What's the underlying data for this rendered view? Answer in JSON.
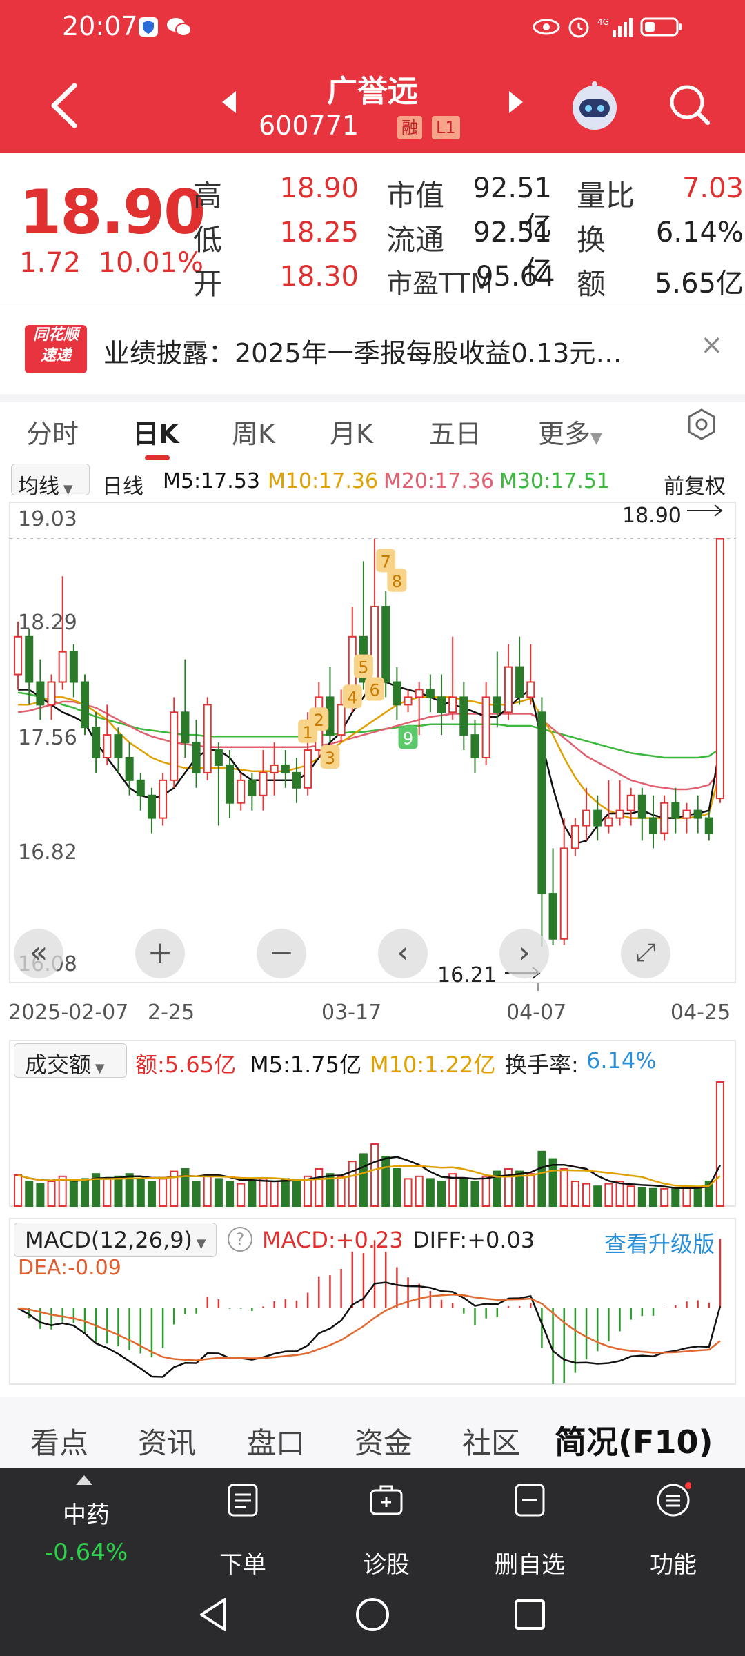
{
  "status_bar": {
    "time": "20:07"
  },
  "header": {
    "name": "广誉远",
    "code": "600771",
    "tags": [
      "融",
      "L1"
    ]
  },
  "quote": {
    "price": "18.90",
    "change": "1.72",
    "change_pct": "10.01%",
    "high_label": "高",
    "high": "18.90",
    "low_label": "低",
    "low": "18.25",
    "open_label": "开",
    "open": "18.30",
    "mktcap_label": "市值",
    "mktcap": "92.51亿",
    "float_label": "流通",
    "float": "92.51亿",
    "pe_label": "市盈TTM",
    "pe": "95.64",
    "vol_ratio_label": "量比",
    "vol_ratio": "7.03",
    "turnover_label": "换",
    "turnover": "6.14%",
    "amount_label": "额",
    "amount": "5.65亿"
  },
  "news": {
    "logo_line1": "同花顺",
    "logo_line2": "速递",
    "text": "业绩披露：2025年一季报每股收益0.13元…",
    "close": "×"
  },
  "tabs": [
    "分时",
    "日K",
    "周K",
    "月K",
    "五日",
    "更多"
  ],
  "active_tab": "日K",
  "legend": {
    "ma_select": "均线",
    "period": "日线",
    "m5": "M5:17.53",
    "m10": "M10:17.36",
    "m20": "M20:17.36",
    "m30": "M30:17.51",
    "adjust": "前复权",
    "colors": {
      "m5": "#111111",
      "m10": "#e0a000",
      "m20": "#e06070",
      "m30": "#3cb83c"
    }
  },
  "chart_data": {
    "type": "candlestick",
    "y_ticks": [
      "19.03",
      "18.29",
      "17.56",
      "16.82",
      "16.08"
    ],
    "ylim": [
      16.08,
      19.03
    ],
    "x_labels": [
      "2025-02-07",
      "2-25",
      "03-17",
      "04-07",
      "04-25"
    ],
    "max_marker": "18.90",
    "min_marker": "16.21",
    "signal_labels": [
      "1",
      "2",
      "3",
      "4",
      "5",
      "6",
      "7",
      "8",
      "9"
    ],
    "candles": [
      [
        18.0,
        18.25,
        17.9,
        18.35
      ],
      [
        18.25,
        17.95,
        17.8,
        18.3
      ],
      [
        17.95,
        17.8,
        17.7,
        18.1
      ],
      [
        17.8,
        17.95,
        17.7,
        18.0
      ],
      [
        17.95,
        18.15,
        17.9,
        18.65
      ],
      [
        18.15,
        17.95,
        17.85,
        18.2
      ],
      [
        17.95,
        17.65,
        17.6,
        18.0
      ],
      [
        17.65,
        17.45,
        17.35,
        17.75
      ],
      [
        17.45,
        17.6,
        17.4,
        17.8
      ],
      [
        17.6,
        17.45,
        17.35,
        17.65
      ],
      [
        17.45,
        17.3,
        17.2,
        17.55
      ],
      [
        17.3,
        17.2,
        17.1,
        17.35
      ],
      [
        17.2,
        17.05,
        16.95,
        17.25
      ],
      [
        17.05,
        17.3,
        17.0,
        17.35
      ],
      [
        17.3,
        17.75,
        17.25,
        17.85
      ],
      [
        17.75,
        17.55,
        17.45,
        18.1
      ],
      [
        17.55,
        17.35,
        17.25,
        17.7
      ],
      [
        17.35,
        17.8,
        17.3,
        17.85
      ],
      [
        17.5,
        17.4,
        17.0,
        17.55
      ],
      [
        17.4,
        17.15,
        17.05,
        17.5
      ],
      [
        17.15,
        17.3,
        17.1,
        17.35
      ],
      [
        17.3,
        17.2,
        17.1,
        17.35
      ],
      [
        17.2,
        17.35,
        17.1,
        17.5
      ],
      [
        17.35,
        17.4,
        17.2,
        17.55
      ],
      [
        17.4,
        17.35,
        17.25,
        17.5
      ],
      [
        17.35,
        17.25,
        17.15,
        17.45
      ],
      [
        17.25,
        17.5,
        17.2,
        17.75
      ],
      [
        17.5,
        17.85,
        17.45,
        17.95
      ],
      [
        17.85,
        17.6,
        17.55,
        18.05
      ],
      [
        17.6,
        17.8,
        17.55,
        17.9
      ],
      [
        17.8,
        18.25,
        17.75,
        18.45
      ],
      [
        18.25,
        17.95,
        17.9,
        18.75
      ],
      [
        17.95,
        18.45,
        17.9,
        18.9
      ],
      [
        18.45,
        17.95,
        17.85,
        18.55
      ],
      [
        17.95,
        17.8,
        17.7,
        18.05
      ],
      [
        17.8,
        17.85,
        17.75,
        17.9
      ],
      [
        17.85,
        17.9,
        17.6,
        17.95
      ],
      [
        17.9,
        17.85,
        17.75,
        18.0
      ],
      [
        17.85,
        17.75,
        17.6,
        18.0
      ],
      [
        17.75,
        17.85,
        17.7,
        18.25
      ],
      [
        17.85,
        17.6,
        17.5,
        17.95
      ],
      [
        17.6,
        17.45,
        17.35,
        17.7
      ],
      [
        17.45,
        17.85,
        17.4,
        17.95
      ],
      [
        17.85,
        17.75,
        17.65,
        18.15
      ],
      [
        17.75,
        18.05,
        17.7,
        18.2
      ],
      [
        18.05,
        17.85,
        17.8,
        18.25
      ],
      [
        17.85,
        17.95,
        17.8,
        18.2
      ],
      [
        17.75,
        16.55,
        16.2,
        17.85
      ],
      [
        16.55,
        16.25,
        16.21,
        16.85
      ],
      [
        16.25,
        16.85,
        16.21,
        17.05
      ],
      [
        16.85,
        17.0,
        16.8,
        17.05
      ],
      [
        17.0,
        17.1,
        16.9,
        17.25
      ],
      [
        17.1,
        17.0,
        16.9,
        17.2
      ],
      [
        17.0,
        17.05,
        16.95,
        17.3
      ],
      [
        17.05,
        17.1,
        17.0,
        17.3
      ],
      [
        17.1,
        17.2,
        17.0,
        17.25
      ],
      [
        17.2,
        17.05,
        16.9,
        17.25
      ],
      [
        17.05,
        16.95,
        16.85,
        17.2
      ],
      [
        16.95,
        17.15,
        16.9,
        17.2
      ],
      [
        17.15,
        17.05,
        16.95,
        17.25
      ],
      [
        17.05,
        17.1,
        16.95,
        17.15
      ],
      [
        17.1,
        17.05,
        16.95,
        17.2
      ],
      [
        17.05,
        16.95,
        16.9,
        17.1
      ],
      [
        17.18,
        18.9,
        17.15,
        18.9
      ]
    ],
    "ma_series": {
      "m5": [
        17.9,
        17.9,
        17.85,
        17.8,
        17.75,
        17.72,
        17.68,
        17.55,
        17.45,
        17.35,
        17.25,
        17.2,
        17.18,
        17.2,
        17.25,
        17.35,
        17.45,
        17.5,
        17.5,
        17.45,
        17.35,
        17.3,
        17.3,
        17.3,
        17.3,
        17.3,
        17.35,
        17.45,
        17.55,
        17.62,
        17.75,
        17.85,
        17.95,
        17.95,
        17.92,
        17.9,
        17.88,
        17.85,
        17.82,
        17.8,
        17.78,
        17.75,
        17.72,
        17.72,
        17.78,
        17.85,
        17.9,
        17.55,
        17.25,
        17.0,
        16.88,
        16.9,
        17.0,
        17.08,
        17.08,
        17.08,
        17.1,
        17.07,
        17.05,
        17.05,
        17.07,
        17.08,
        17.1,
        17.53
      ],
      "m10": [
        17.8,
        17.8,
        17.82,
        17.85,
        17.85,
        17.83,
        17.8,
        17.75,
        17.7,
        17.62,
        17.55,
        17.5,
        17.45,
        17.42,
        17.4,
        17.38,
        17.38,
        17.38,
        17.38,
        17.38,
        17.37,
        17.36,
        17.36,
        17.36,
        17.36,
        17.38,
        17.4,
        17.45,
        17.5,
        17.55,
        17.6,
        17.65,
        17.7,
        17.75,
        17.8,
        17.83,
        17.85,
        17.85,
        17.85,
        17.85,
        17.83,
        17.82,
        17.8,
        17.8,
        17.8,
        17.82,
        17.84,
        17.72,
        17.6,
        17.45,
        17.32,
        17.22,
        17.15,
        17.1,
        17.07,
        17.05,
        17.05,
        17.05,
        17.05,
        17.05,
        17.05,
        17.06,
        17.08,
        17.36
      ],
      "m20": [
        17.75,
        17.76,
        17.78,
        17.8,
        17.82,
        17.82,
        17.8,
        17.78,
        17.74,
        17.7,
        17.66,
        17.62,
        17.59,
        17.57,
        17.55,
        17.54,
        17.53,
        17.52,
        17.52,
        17.52,
        17.52,
        17.52,
        17.52,
        17.52,
        17.52,
        17.52,
        17.52,
        17.53,
        17.54,
        17.56,
        17.58,
        17.6,
        17.62,
        17.64,
        17.66,
        17.68,
        17.7,
        17.72,
        17.73,
        17.74,
        17.74,
        17.74,
        17.74,
        17.74,
        17.74,
        17.74,
        17.74,
        17.7,
        17.64,
        17.58,
        17.52,
        17.46,
        17.42,
        17.38,
        17.34,
        17.3,
        17.28,
        17.26,
        17.25,
        17.24,
        17.24,
        17.25,
        17.27,
        17.36
      ],
      "m30": [
        17.88,
        17.87,
        17.85,
        17.83,
        17.8,
        17.78,
        17.75,
        17.72,
        17.7,
        17.68,
        17.66,
        17.64,
        17.63,
        17.62,
        17.61,
        17.6,
        17.6,
        17.59,
        17.59,
        17.59,
        17.59,
        17.59,
        17.59,
        17.59,
        17.59,
        17.59,
        17.59,
        17.6,
        17.6,
        17.61,
        17.62,
        17.62,
        17.63,
        17.64,
        17.65,
        17.66,
        17.66,
        17.67,
        17.67,
        17.67,
        17.67,
        17.67,
        17.67,
        17.67,
        17.66,
        17.66,
        17.66,
        17.64,
        17.62,
        17.6,
        17.58,
        17.56,
        17.54,
        17.52,
        17.5,
        17.48,
        17.47,
        17.46,
        17.45,
        17.45,
        17.45,
        17.45,
        17.46,
        17.51
      ]
    }
  },
  "volume": {
    "select": "成交额",
    "amount": "额:5.65亿",
    "m5": "M5:1.75亿",
    "m10": "M10:1.22亿",
    "turnover_label": "换手率:",
    "turnover": "6.14%",
    "bars": [
      0.25,
      0.2,
      0.18,
      0.2,
      0.24,
      0.2,
      0.22,
      0.26,
      0.22,
      0.24,
      0.26,
      0.22,
      0.2,
      0.22,
      0.28,
      0.3,
      0.2,
      0.25,
      0.22,
      0.2,
      0.18,
      0.2,
      0.22,
      0.2,
      0.22,
      0.2,
      0.24,
      0.3,
      0.26,
      0.24,
      0.36,
      0.42,
      0.5,
      0.4,
      0.3,
      0.22,
      0.24,
      0.22,
      0.2,
      0.26,
      0.22,
      0.2,
      0.24,
      0.28,
      0.3,
      0.28,
      0.26,
      0.44,
      0.38,
      0.3,
      0.2,
      0.18,
      0.16,
      0.18,
      0.2,
      0.16,
      0.15,
      0.14,
      0.14,
      0.14,
      0.16,
      0.15,
      0.2,
      1.0
    ]
  },
  "macd": {
    "select": "MACD(12,26,9)",
    "help": "?",
    "macd": "MACD:+0.23",
    "diff": "DIFF:+0.03",
    "dea": "DEA:-0.09",
    "upgrade": "查看升级版"
  },
  "nav_buttons": [
    "«",
    "+",
    "−",
    "‹",
    "›",
    "⤢"
  ],
  "bottom_tabs": [
    "看点",
    "资讯",
    "盘口",
    "资金",
    "社区",
    "简况(F10)"
  ],
  "dock": {
    "sector_name": "中药",
    "sector_change": "-0.64%",
    "items": [
      "下单",
      "诊股",
      "删自选",
      "功能"
    ]
  }
}
